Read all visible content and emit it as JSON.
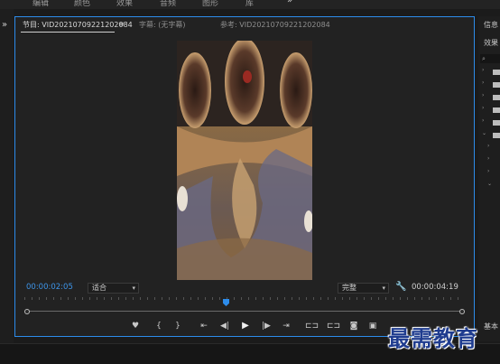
{
  "workspaces": [
    "编辑",
    "颜色",
    "效果",
    "音频",
    "图形",
    "库"
  ],
  "workspaces_more": "»",
  "left_collapse": "»",
  "monitor": {
    "tabs": [
      {
        "label": "节目: VID20210709221202084",
        "active": true
      },
      {
        "label": "字幕: (无字幕)",
        "active": false
      },
      {
        "label": "参考: VID20210709221202084",
        "active": false
      }
    ],
    "menu_glyph": "≡",
    "current_time": "00:00:02:05",
    "fit_select": "适合",
    "quality_select": "完整",
    "duration": "00:00:04:19",
    "playhead_position": 0.457,
    "transport_buttons": [
      {
        "name": "add-marker",
        "glyph": "♥"
      },
      {
        "name": "mark-in",
        "glyph": "{"
      },
      {
        "name": "mark-out",
        "glyph": "}"
      },
      {
        "name": "go-to-in",
        "glyph": "⇤"
      },
      {
        "name": "step-back",
        "glyph": "◀|"
      },
      {
        "name": "play",
        "glyph": "▶"
      },
      {
        "name": "step-forward",
        "glyph": "|▶"
      },
      {
        "name": "go-to-out",
        "glyph": "⇥"
      },
      {
        "name": "lift",
        "glyph": "⊏⊐"
      },
      {
        "name": "extract",
        "glyph": "⊏⊐"
      },
      {
        "name": "export-frame",
        "glyph": "◙"
      },
      {
        "name": "comparison-view",
        "glyph": "▣"
      }
    ]
  },
  "right_panel": {
    "info_label": "信息",
    "effects_label": "效果",
    "search_glyph": "⌕",
    "base_label": "基本"
  },
  "watermark": "最需教育"
}
